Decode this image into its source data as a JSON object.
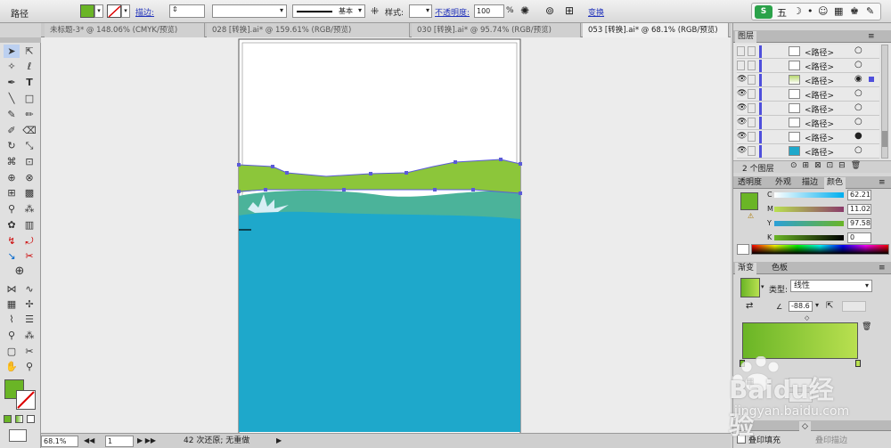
{
  "control": {
    "object_type": "路径",
    "stroke_label": "描边:",
    "style_label": "样式:",
    "opacity_label": "不透明度:",
    "opacity_value": "100",
    "percent": "%",
    "stroke_profile": "基本",
    "transform_label": "变换"
  },
  "ime": {
    "label": "五"
  },
  "tabs": [
    {
      "label": "未标题-3* @ 148.06% (CMYK/预览)"
    },
    {
      "label": "028 [转换].ai* @ 159.61% (RGB/预览)"
    },
    {
      "label": "030 [转换].ai* @ 95.74% (RGB/预览)"
    },
    {
      "label": "053 [转换].ai* @ 68.1% (RGB/预览)"
    }
  ],
  "layers": {
    "title": "图层",
    "count_label": "2 个图层",
    "items": [
      {
        "name": "<路径>"
      },
      {
        "name": "<路径>"
      },
      {
        "name": "<路径>"
      },
      {
        "name": "<路径>"
      },
      {
        "name": "<路径>"
      },
      {
        "name": "<路径>"
      },
      {
        "name": "<路径>"
      },
      {
        "name": "<路径>"
      }
    ]
  },
  "color_panel": {
    "tabs": [
      "透明度",
      "外观",
      "描边",
      "颜色"
    ],
    "C": "62.21",
    "M": "11.02",
    "Y": "97.58",
    "K": "0",
    "swatch": "#6ab526"
  },
  "gradient": {
    "tabs": [
      "渐变",
      "色板"
    ],
    "type_label": "类型:",
    "type_value": "线性",
    "angle": "-88.6",
    "from": "#6ab526",
    "to": "#b9e050"
  },
  "bottom": {
    "fill_label": "叠印填充",
    "stroke_label": "叠印描边"
  },
  "status": {
    "zoom": "68.1%",
    "page": "1",
    "message": "42 次还原; 无重做"
  },
  "colors": {
    "fill": "#6ab526",
    "water": "#1ea8cb",
    "grass": "#8cc63a"
  },
  "watermark": {
    "text": "Baidu经验",
    "url": "jingyan.baidu.com"
  }
}
